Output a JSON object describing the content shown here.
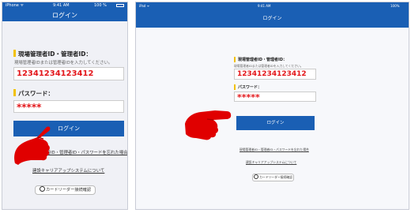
{
  "phone": {
    "status": {
      "carrier": "iPhone ᯤ",
      "time": "9:41 AM",
      "battery": "100 %"
    },
    "title": "ログイン",
    "id_label": "現場管理者ID・管理者ID：",
    "id_hint": "現場管理者IDまたは管理者IDを入力してください。",
    "id_value": "12341234123412",
    "password_label": "パスワード：",
    "password_value": "*****",
    "login_button": "ログイン",
    "forgot_link": "現場管理者ID・管理者ID・パスワードを忘れた場合",
    "about_link": "建設キャリアアップシステムについて",
    "card_reader_button": "カードリーダー接続確認"
  },
  "ipad": {
    "status": {
      "carrier": "iPad ᯤ",
      "time": "9:41 AM",
      "battery": "100%"
    },
    "title": "ログイン",
    "id_label": "現場管理者ID・管理者ID：",
    "id_hint": "現場管理者IDまたは管理者IDを入力してください。",
    "id_value": "12341234123412",
    "password_label": "パスワード：",
    "password_value": "*****",
    "login_button": "ログイン",
    "forgot_link": "現場管理者ID・管理者ID・パスワードを忘れた場合",
    "about_link": "建設キャリアアップシステムについて",
    "card_reader_button": "カードリーダー接続確認"
  },
  "icons": {
    "pointer": "pointing-hand-icon",
    "check": "check-circle-icon",
    "battery": "battery-icon"
  },
  "colors": {
    "brand_blue": "#1a5fb4",
    "input_red": "#e3161a",
    "accent_yellow": "#f2c100",
    "hand_red": "#e00000"
  }
}
